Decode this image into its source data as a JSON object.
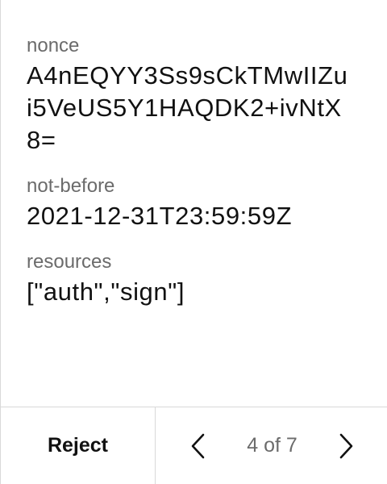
{
  "fields": [
    {
      "label": "nonce",
      "value": "A4nEQYY3Ss9sCkTMwIIZui5VeUS5Y1HAQDK2+ivNtX8="
    },
    {
      "label": "not-before",
      "value": "2021-12-31T23:59:59Z"
    },
    {
      "label": "resources",
      "value": "[\"auth\",\"sign\"]"
    }
  ],
  "footer": {
    "reject_label": "Reject",
    "pager_text": "4 of 7",
    "prev_icon": "chevron-left-icon",
    "next_icon": "chevron-right-icon"
  }
}
